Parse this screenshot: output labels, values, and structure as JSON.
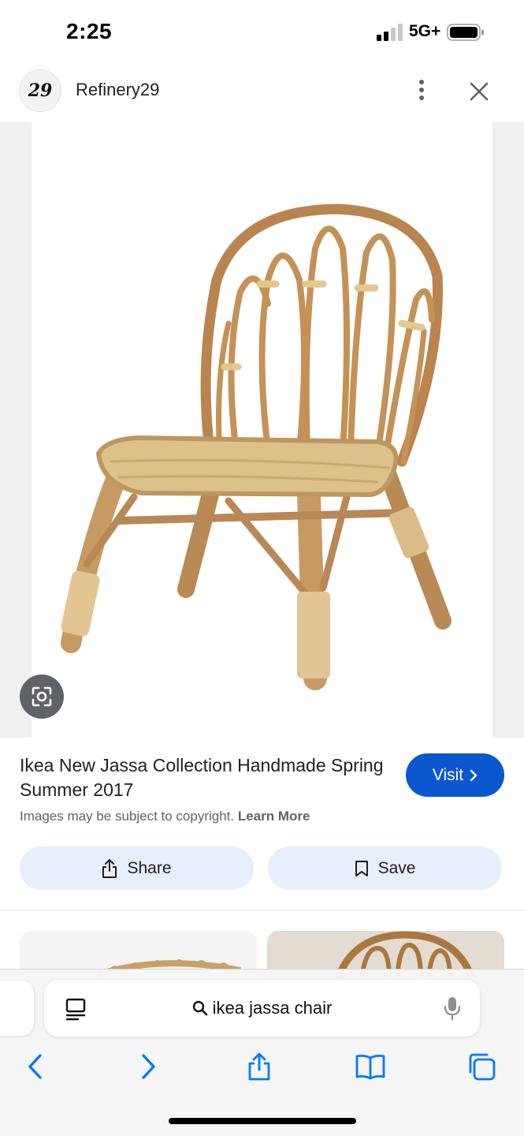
{
  "status_bar": {
    "time": "2:25",
    "network": "5G+"
  },
  "header": {
    "logo_text": "29",
    "site_name": "Refinery29"
  },
  "result": {
    "title": "Ikea New Jassa Collection Handmade Spring Summer 2017",
    "visit_label": "Visit",
    "copyright_text": "Images may be subject to copyright.",
    "learn_more_label": "Learn More",
    "share_label": "Share",
    "save_label": "Save"
  },
  "browser": {
    "search_query": "ikea jassa chair"
  },
  "colors": {
    "accent": "#0b57d0",
    "action_bg": "#e7eefc",
    "ios_blue": "#007aff",
    "rattan": "#c9a06a"
  },
  "icons": {
    "more": "more-vert-icon",
    "close": "close-icon",
    "lens": "lens-icon",
    "visit": "chevron-right-icon",
    "share": "share-icon",
    "save": "bookmark-icon",
    "reader": "reader-icon",
    "search": "search-icon",
    "mic": "mic-icon",
    "back": "back-icon",
    "forward": "forward-icon",
    "bookmarks": "book-icon",
    "tabs": "tabs-icon"
  }
}
